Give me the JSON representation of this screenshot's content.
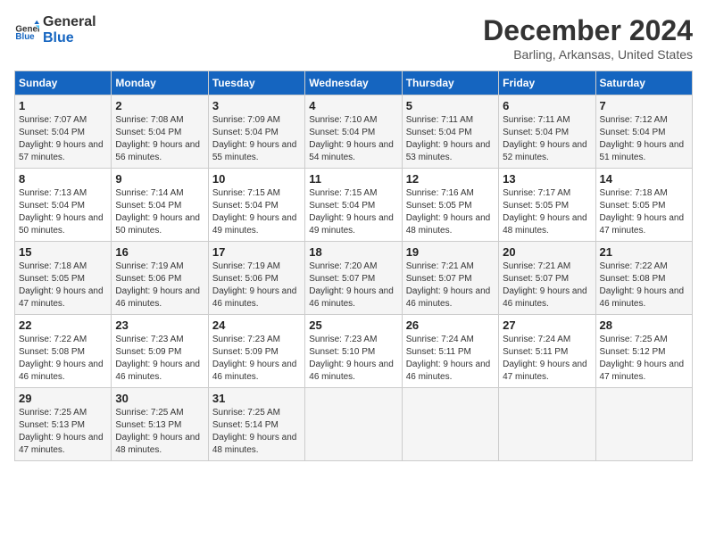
{
  "logo": {
    "line1": "General",
    "line2": "Blue"
  },
  "title": "December 2024",
  "location": "Barling, Arkansas, United States",
  "days_of_week": [
    "Sunday",
    "Monday",
    "Tuesday",
    "Wednesday",
    "Thursday",
    "Friday",
    "Saturday"
  ],
  "weeks": [
    [
      {
        "day": "1",
        "sunrise": "7:07 AM",
        "sunset": "5:04 PM",
        "daylight": "9 hours and 57 minutes."
      },
      {
        "day": "2",
        "sunrise": "7:08 AM",
        "sunset": "5:04 PM",
        "daylight": "9 hours and 56 minutes."
      },
      {
        "day": "3",
        "sunrise": "7:09 AM",
        "sunset": "5:04 PM",
        "daylight": "9 hours and 55 minutes."
      },
      {
        "day": "4",
        "sunrise": "7:10 AM",
        "sunset": "5:04 PM",
        "daylight": "9 hours and 54 minutes."
      },
      {
        "day": "5",
        "sunrise": "7:11 AM",
        "sunset": "5:04 PM",
        "daylight": "9 hours and 53 minutes."
      },
      {
        "day": "6",
        "sunrise": "7:11 AM",
        "sunset": "5:04 PM",
        "daylight": "9 hours and 52 minutes."
      },
      {
        "day": "7",
        "sunrise": "7:12 AM",
        "sunset": "5:04 PM",
        "daylight": "9 hours and 51 minutes."
      }
    ],
    [
      {
        "day": "8",
        "sunrise": "7:13 AM",
        "sunset": "5:04 PM",
        "daylight": "9 hours and 50 minutes."
      },
      {
        "day": "9",
        "sunrise": "7:14 AM",
        "sunset": "5:04 PM",
        "daylight": "9 hours and 50 minutes."
      },
      {
        "day": "10",
        "sunrise": "7:15 AM",
        "sunset": "5:04 PM",
        "daylight": "9 hours and 49 minutes."
      },
      {
        "day": "11",
        "sunrise": "7:15 AM",
        "sunset": "5:04 PM",
        "daylight": "9 hours and 49 minutes."
      },
      {
        "day": "12",
        "sunrise": "7:16 AM",
        "sunset": "5:05 PM",
        "daylight": "9 hours and 48 minutes."
      },
      {
        "day": "13",
        "sunrise": "7:17 AM",
        "sunset": "5:05 PM",
        "daylight": "9 hours and 48 minutes."
      },
      {
        "day": "14",
        "sunrise": "7:18 AM",
        "sunset": "5:05 PM",
        "daylight": "9 hours and 47 minutes."
      }
    ],
    [
      {
        "day": "15",
        "sunrise": "7:18 AM",
        "sunset": "5:05 PM",
        "daylight": "9 hours and 47 minutes."
      },
      {
        "day": "16",
        "sunrise": "7:19 AM",
        "sunset": "5:06 PM",
        "daylight": "9 hours and 46 minutes."
      },
      {
        "day": "17",
        "sunrise": "7:19 AM",
        "sunset": "5:06 PM",
        "daylight": "9 hours and 46 minutes."
      },
      {
        "day": "18",
        "sunrise": "7:20 AM",
        "sunset": "5:07 PM",
        "daylight": "9 hours and 46 minutes."
      },
      {
        "day": "19",
        "sunrise": "7:21 AM",
        "sunset": "5:07 PM",
        "daylight": "9 hours and 46 minutes."
      },
      {
        "day": "20",
        "sunrise": "7:21 AM",
        "sunset": "5:07 PM",
        "daylight": "9 hours and 46 minutes."
      },
      {
        "day": "21",
        "sunrise": "7:22 AM",
        "sunset": "5:08 PM",
        "daylight": "9 hours and 46 minutes."
      }
    ],
    [
      {
        "day": "22",
        "sunrise": "7:22 AM",
        "sunset": "5:08 PM",
        "daylight": "9 hours and 46 minutes."
      },
      {
        "day": "23",
        "sunrise": "7:23 AM",
        "sunset": "5:09 PM",
        "daylight": "9 hours and 46 minutes."
      },
      {
        "day": "24",
        "sunrise": "7:23 AM",
        "sunset": "5:09 PM",
        "daylight": "9 hours and 46 minutes."
      },
      {
        "day": "25",
        "sunrise": "7:23 AM",
        "sunset": "5:10 PM",
        "daylight": "9 hours and 46 minutes."
      },
      {
        "day": "26",
        "sunrise": "7:24 AM",
        "sunset": "5:11 PM",
        "daylight": "9 hours and 46 minutes."
      },
      {
        "day": "27",
        "sunrise": "7:24 AM",
        "sunset": "5:11 PM",
        "daylight": "9 hours and 47 minutes."
      },
      {
        "day": "28",
        "sunrise": "7:25 AM",
        "sunset": "5:12 PM",
        "daylight": "9 hours and 47 minutes."
      }
    ],
    [
      {
        "day": "29",
        "sunrise": "7:25 AM",
        "sunset": "5:13 PM",
        "daylight": "9 hours and 47 minutes."
      },
      {
        "day": "30",
        "sunrise": "7:25 AM",
        "sunset": "5:13 PM",
        "daylight": "9 hours and 48 minutes."
      },
      {
        "day": "31",
        "sunrise": "7:25 AM",
        "sunset": "5:14 PM",
        "daylight": "9 hours and 48 minutes."
      },
      null,
      null,
      null,
      null
    ]
  ]
}
